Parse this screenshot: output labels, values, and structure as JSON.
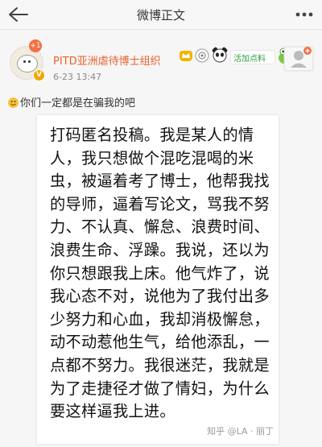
{
  "nav": {
    "title": "微博正文"
  },
  "post": {
    "username": "PITD亚洲虐待博士组织",
    "avatar_badge": "+1",
    "verified_badge": "V",
    "badge_icons": [
      "crown-badge-icon",
      "fan-badge-icon",
      "panda-badge-icon",
      "hot-activity-badge-icon",
      "frog-badge-icon"
    ],
    "badge_text": "活加点料",
    "time": "6-23 13:47",
    "text": "你们一定都是在骗我的吧",
    "image": {
      "lines": [
        "打码匿名投稿。我是某人的情",
        "人，我只想做个混吃混喝的米",
        "虫，被逼着考了博士，他帮我找",
        "的导师，逼着写论文，骂我不努",
        "力、不认真、懈怠、浪费时间、",
        "浪费生命、浮躁。我说，还以为",
        "你只想跟我上床。他气炸了，说",
        "我心态不对，说他为了我付出多",
        "少努力和心血，我却消极懈怠，",
        "动不动惹他生气，给他添乱，一",
        "点都不努力。我很迷茫，我就是",
        "为了走捷径才做了情妇，为什么",
        "要这样逼我上进。"
      ],
      "watermark": "知乎 @LA · 丽丁"
    }
  },
  "colors": {
    "username": "#e8612c",
    "badge_v": "#f2a600",
    "badge_plus": "#f36f44"
  }
}
